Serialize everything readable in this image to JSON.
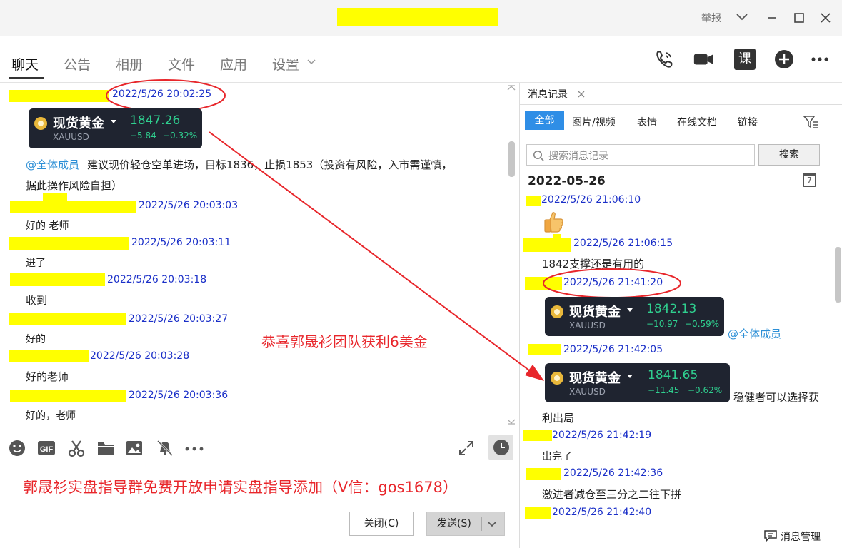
{
  "window": {
    "report_label": "举报",
    "minimize": "—",
    "maximize": "□",
    "close": "✕"
  },
  "nav": {
    "tabs": [
      "聊天",
      "公告",
      "相册",
      "文件",
      "应用",
      "设置"
    ],
    "icons": [
      "phone-icon",
      "video-call-icon",
      "course-icon",
      "add-icon",
      "more-icon"
    ],
    "course_label": "课",
    "more_label": "•••"
  },
  "chat": {
    "messages": [
      {
        "time": "2022/5/26 20:02:25"
      },
      {
        "mention": "@全体成员",
        "text1": "建议现价轻仓空单进场，目标1836，止损1853（投资有风险，入市需谨慎，",
        "text2": "据此操作风险自担）"
      },
      {
        "time": "2022/5/26 20:03:03",
        "text": "好的  老师"
      },
      {
        "time": "2022/5/26 20:03:11",
        "text": "进了"
      },
      {
        "time": "2022/5/26 20:03:18",
        "text": "收到"
      },
      {
        "time": "2022/5/26 20:03:27",
        "text": "好的"
      },
      {
        "time": "2022/5/26 20:03:28",
        "text": "好的老师"
      },
      {
        "time": "2022/5/26 20:03:36",
        "text": "好的，老师"
      }
    ],
    "card": {
      "name": "现货黄金",
      "symbol": "XAUUSD",
      "price": "1847.26",
      "change": "−5.84",
      "pct": "−0.32%"
    },
    "overlay_text": "恭喜郭晟衫团队获利6美金",
    "promo_text": "郭晟衫实盘指导群免费开放申请实盘指导添加（V信：gos1678）",
    "close_button": "关闭(C)",
    "send_button": "发送(S)"
  },
  "history": {
    "tab_label": "消息记录",
    "filters": [
      "全部",
      "图片/视频",
      "表情",
      "在线文档",
      "链接"
    ],
    "search_placeholder": "搜索消息记录",
    "search_button": "搜索",
    "date": "2022-05-26",
    "calendar_day": "7",
    "messages": [
      {
        "time": "2022/5/26 21:06:10"
      },
      {
        "time": "2022/5/26 21:06:15",
        "text": "1842支撑还是有用的"
      },
      {
        "time": "2022/5/26 21:41:20"
      },
      {
        "time": "2022/5/26 21:42:05"
      },
      {
        "time": "2022/5/26 21:42:19",
        "text": "出完了"
      },
      {
        "time": "2022/5/26 21:42:36",
        "text": "激进者减仓至三分之二往下拼"
      },
      {
        "time": "2022/5/26 21:42:40"
      }
    ],
    "card1": {
      "name": "现货黄金",
      "symbol": "XAUUSD",
      "price": "1842.13",
      "change": "−10.97",
      "pct": "−0.59%"
    },
    "card1_mention": "@全体成员",
    "card2": {
      "name": "现货黄金",
      "symbol": "XAUUSD",
      "price": "1841.65",
      "change": "−11.45",
      "pct": "−0.62%"
    },
    "card2_text1": "稳健者可以选择获",
    "card2_text2": "利出局",
    "manage_label": "消息管理"
  },
  "colors": {
    "highlight": "#ffff00",
    "timestamp": "#1a2fc8",
    "annotation": "#e8262b",
    "mention": "#2c8fd6",
    "accent": "#2f8ee6"
  }
}
